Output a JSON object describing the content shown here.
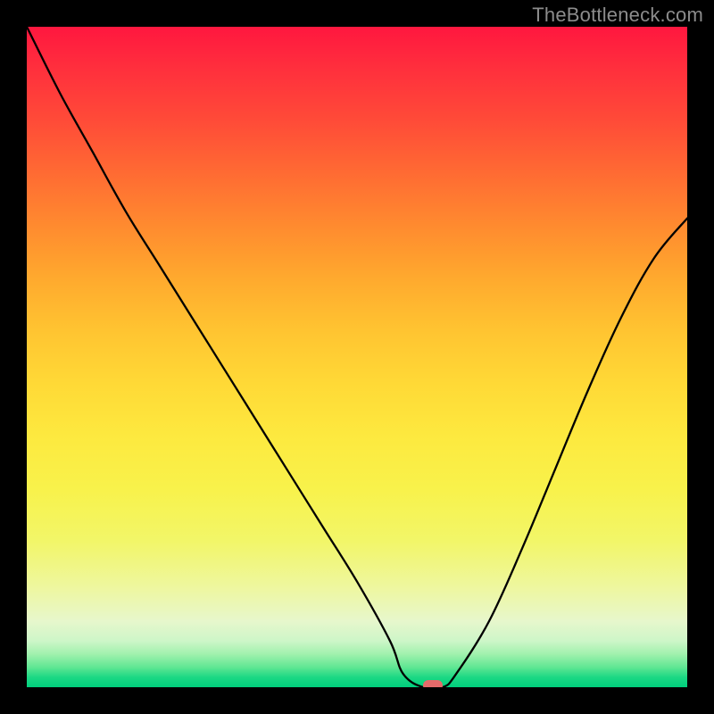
{
  "watermark": "TheBottleneck.com",
  "colors": {
    "gradient_top": "#ff173f",
    "gradient_bottom": "#00cf7d",
    "curve": "#000000",
    "marker": "#e46a6a",
    "frame": "#000000"
  },
  "chart_data": {
    "type": "line",
    "title": "",
    "xlabel": "",
    "ylabel": "",
    "xlim": [
      0,
      100
    ],
    "ylim": [
      0,
      100
    ],
    "grid": false,
    "series": [
      {
        "name": "bottleneck-curve",
        "x": [
          0,
          5,
          10,
          15,
          20,
          25,
          30,
          35,
          40,
          45,
          50,
          55,
          57,
          60,
          63,
          65,
          70,
          75,
          80,
          85,
          90,
          95,
          100
        ],
        "y": [
          100,
          90,
          81,
          72,
          64,
          56,
          48,
          40,
          32,
          24,
          16,
          7,
          2,
          0,
          0,
          2,
          10,
          21,
          33,
          45,
          56,
          65,
          71
        ]
      }
    ],
    "annotations": [
      {
        "name": "minimum-marker",
        "x": 61.5,
        "y": 0
      }
    ]
  }
}
